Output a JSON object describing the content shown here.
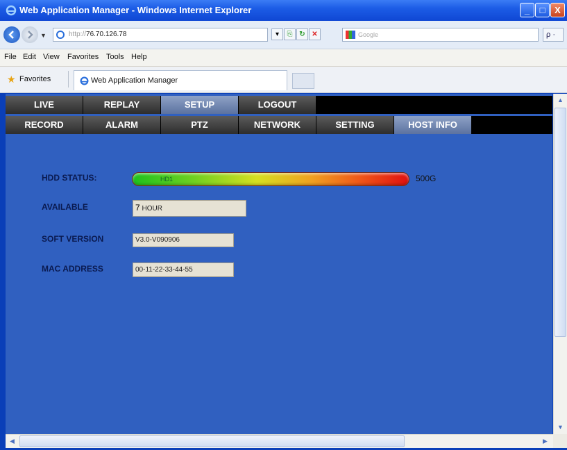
{
  "window": {
    "title": "Web Application Manager - Windows Internet Explorer",
    "min_label": "_",
    "max_label": "□",
    "close_label": "X"
  },
  "navbar": {
    "url_proto": "http://",
    "url_host": "76.70.126.78",
    "search_placeholder": "Google",
    "search_btn": "ρ ·",
    "dropdown": "▼",
    "ctl_dropdown": "▾",
    "ctl_compat": "⎘",
    "ctl_refresh": "↻",
    "ctl_stop": "✕"
  },
  "menu": [
    "File",
    "Edit",
    "View",
    "Favorites",
    "Tools",
    "Help"
  ],
  "favorites": {
    "label": "Favorites",
    "tab_title": "Web Application Manager"
  },
  "app": {
    "nav_top": [
      "LIVE",
      "REPLAY",
      "SETUP",
      "LOGOUT"
    ],
    "nav_top_active": "SETUP",
    "nav_sub": [
      "RECORD",
      "ALARM",
      "PTZ",
      "NETWORK",
      "SETTING",
      "HOST INFO"
    ],
    "nav_sub_active": "HOST INFO",
    "hdd_status_label": "HDD STATUS:",
    "hdd_name": "HD1",
    "hdd_size": "500G",
    "available_label": "AVAILABLE",
    "available_num": "7",
    "available_unit": "HOUR",
    "soft_version_label": "SOFT VERSION",
    "soft_version": "V3.0-V090906",
    "mac_address_label": "MAC ADDRESS",
    "mac_address": "00-11-22-33-44-55"
  },
  "scroll": {
    "up": "▲",
    "down": "▼",
    "left": "◀",
    "right": "▶"
  },
  "colors": {
    "content_bg": "#3060c0",
    "nav_active": "#7a8fb8",
    "label_text": "#0a1a50"
  }
}
